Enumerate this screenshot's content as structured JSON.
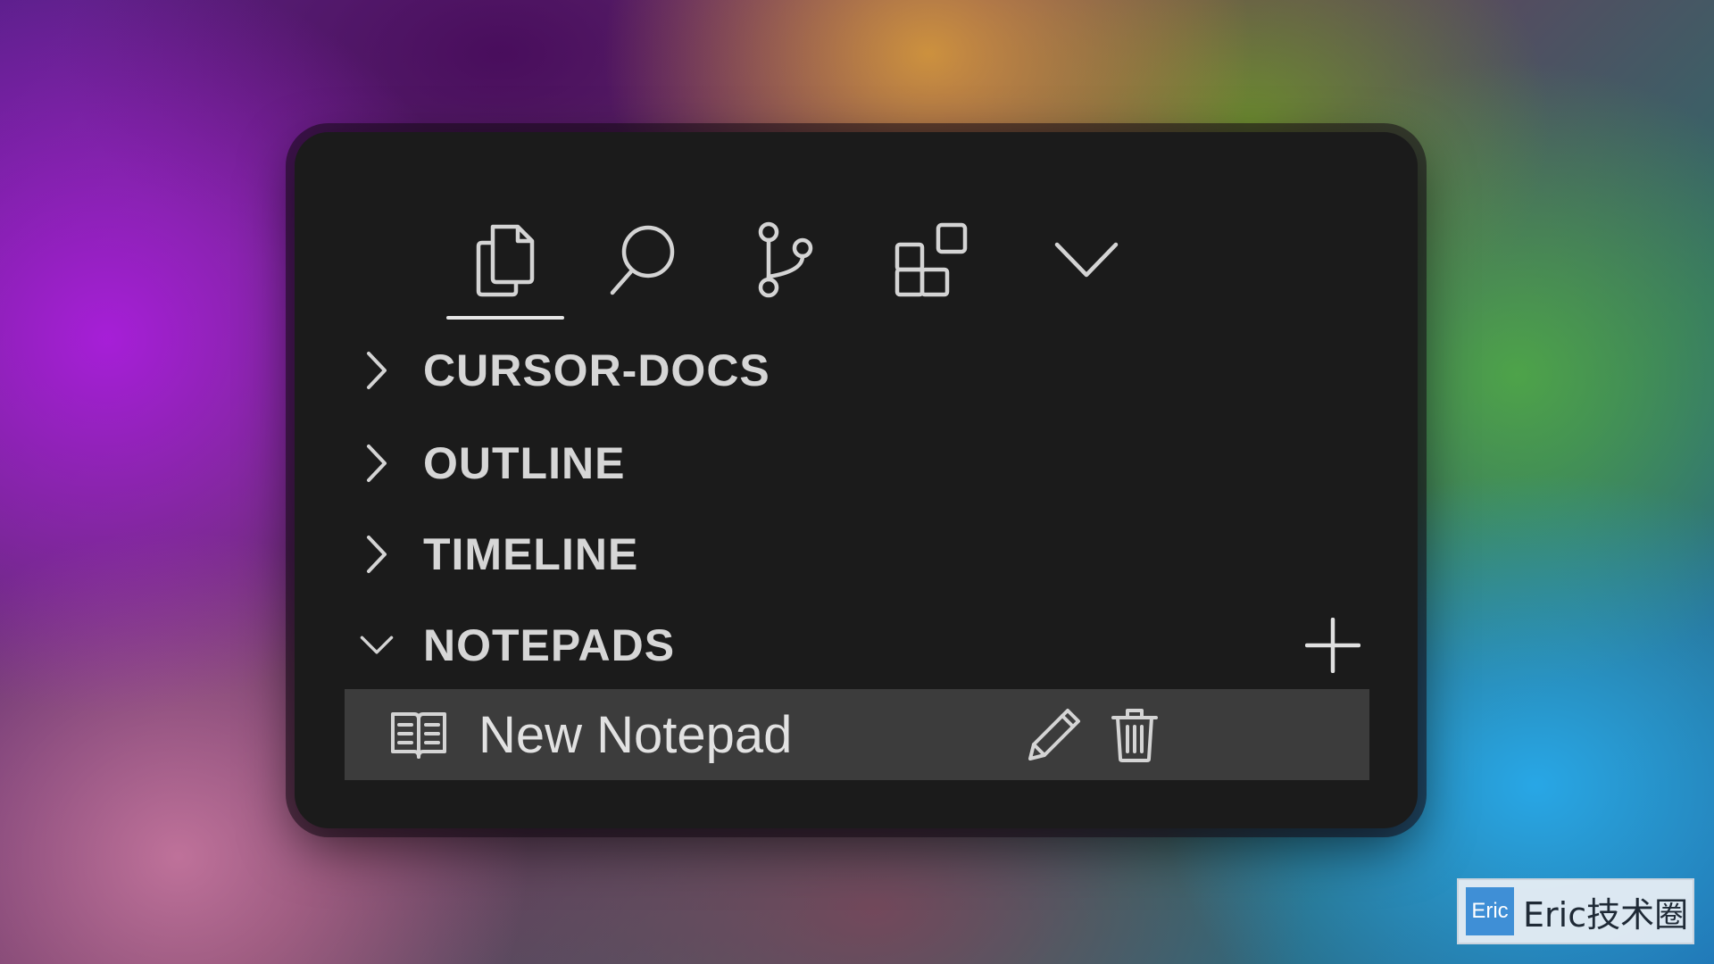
{
  "activity_bar": {
    "items": [
      {
        "icon": "files-icon",
        "active": true
      },
      {
        "icon": "search-icon",
        "active": false
      },
      {
        "icon": "source-control-icon",
        "active": false
      },
      {
        "icon": "extensions-icon",
        "active": false
      },
      {
        "icon": "chevron-down-icon",
        "active": false
      }
    ]
  },
  "sections": {
    "cursor_docs": {
      "title": "CURSOR-DOCS",
      "expanded": false
    },
    "outline": {
      "title": "OUTLINE",
      "expanded": false
    },
    "timeline": {
      "title": "TIMELINE",
      "expanded": false
    },
    "notepads": {
      "title": "NOTEPADS",
      "expanded": true
    }
  },
  "notepads": {
    "items": [
      {
        "label": "New Notepad",
        "icon": "book-icon"
      }
    ]
  },
  "watermark": {
    "logo_text": "Eric",
    "text": "Eric技术圈"
  },
  "colors": {
    "panel_bg": "#1b1b1b",
    "selected_row_bg": "#3c3c3c",
    "text": "#d6d6d6",
    "watermark_accent": "#3f8fd6"
  }
}
